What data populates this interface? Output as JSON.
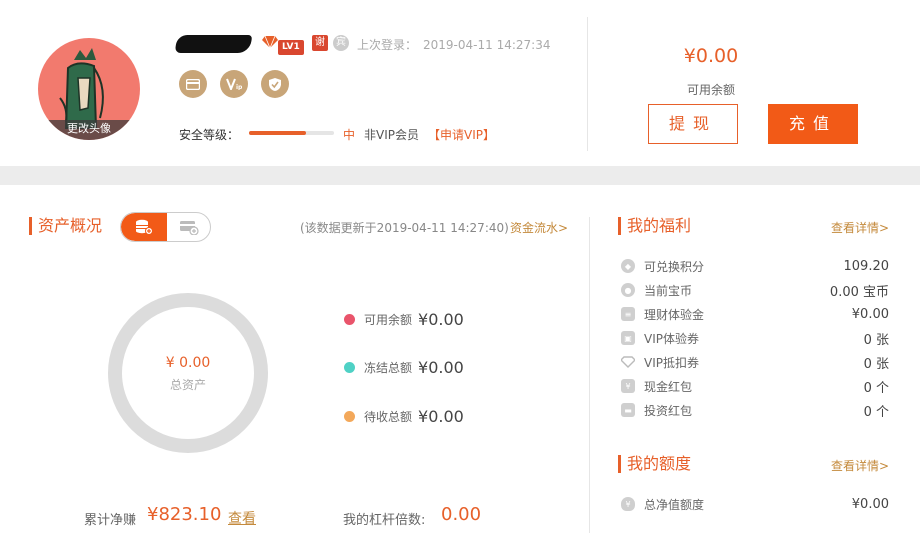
{
  "profile": {
    "avatar_change_label": "更改头像",
    "level_badge": "LV1",
    "small_badge_1": "谢",
    "small_badge_2": "宾",
    "last_login_label": "上次登录：",
    "last_login_time": "2019-04-11 14:27:34",
    "security_label": "安全等级：",
    "security_level_text": "中",
    "security_progress": 0.67,
    "vip_status": "非VIP会员",
    "vip_apply": "【申请VIP】"
  },
  "balance": {
    "amount": "¥0.00",
    "label": "可用余额",
    "withdraw_label": "提现",
    "recharge_label": "充值"
  },
  "assets": {
    "title": "资产概况",
    "updated_text": "(该数据更新于2019-04-11 14:27:40)",
    "flow_link": "资金流水>",
    "total_amount": "¥ 0.00",
    "total_label": "总资产",
    "legend": [
      {
        "label": "可用余额",
        "value": "¥0.00",
        "color": "#e9546b"
      },
      {
        "label": "冻结总额",
        "value": "¥0.00",
        "color": "#4fd1c5"
      },
      {
        "label": "待收总额",
        "value": "¥0.00",
        "color": "#f3a85a"
      }
    ],
    "net_earn_label": "累计净赚",
    "net_earn_value": "¥823.10",
    "net_earn_link": "查看",
    "leverage_label": "我的杠杆倍数:",
    "leverage_value": "0.00"
  },
  "welfare": {
    "title": "我的福利",
    "detail_link": "查看详情>",
    "items": [
      {
        "label": "可兑换积分",
        "value": "109.20"
      },
      {
        "label": "当前宝币",
        "value": "0.00 宝币"
      },
      {
        "label": "理财体验金",
        "value": "¥0.00"
      },
      {
        "label": "VIP体验券",
        "value": "0 张"
      },
      {
        "label": "VIP抵扣券",
        "value": "0 张"
      },
      {
        "label": "现金红包",
        "value": "0 个"
      },
      {
        "label": "投资红包",
        "value": "0 个"
      }
    ]
  },
  "quota": {
    "title": "我的额度",
    "detail_link": "查看详情>",
    "items": [
      {
        "label": "总净值额度",
        "value": "¥0.00"
      }
    ]
  },
  "colors": {
    "accent": "#e7602a",
    "button": "#f25a17",
    "gold": "#c48a3c"
  }
}
